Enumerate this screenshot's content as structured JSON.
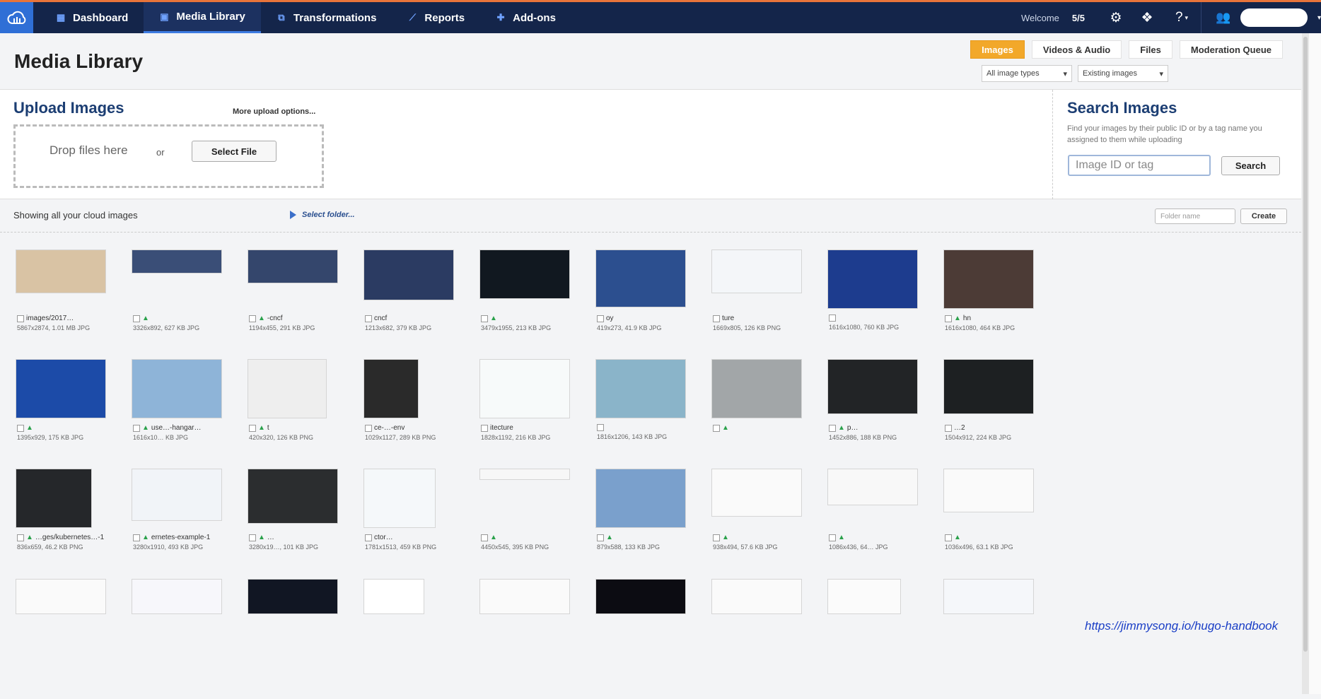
{
  "nav": {
    "items": [
      {
        "label": "Dashboard",
        "icon": "dashboard-icon",
        "glyph": "▦"
      },
      {
        "label": "Media Library",
        "icon": "media-library-icon",
        "glyph": "▣"
      },
      {
        "label": "Transformations",
        "icon": "transformations-icon",
        "glyph": "⧉"
      },
      {
        "label": "Reports",
        "icon": "reports-icon",
        "glyph": "⟋"
      },
      {
        "label": "Add-ons",
        "icon": "puzzle-icon",
        "glyph": "✚"
      }
    ],
    "welcome_label": "Welcome",
    "quota": "5/5"
  },
  "header": {
    "title": "Media Library",
    "tabs": [
      "Images",
      "Videos & Audio",
      "Files",
      "Moderation Queue"
    ],
    "active_tab": "Images",
    "filter_type": "All image types",
    "filter_state": "Existing images"
  },
  "upload": {
    "title": "Upload Images",
    "more_options": "More upload options...",
    "drop_text": "Drop files here",
    "or_text": "or",
    "select_file": "Select File"
  },
  "search": {
    "title": "Search Images",
    "description": "Find your images by their public ID or by a tag name you assigned to them while uploading",
    "placeholder": "Image ID or tag",
    "button": "Search"
  },
  "folders": {
    "showing": "Showing all your cloud images",
    "select_folder": "Select folder...",
    "folder_placeholder": "Folder name",
    "create": "Create"
  },
  "images": [
    {
      "name": "images/2017…",
      "meta": "5867x2874, 1.01 MB JPG",
      "tagged": false,
      "color": "#d9c3a4"
    },
    {
      "name": "",
      "meta": "3326x892, 627 KB JPG",
      "tagged": true,
      "color": "#3a4e77"
    },
    {
      "name": "-cncf",
      "meta": "1194x455, 291 KB JPG",
      "tagged": true,
      "color": "#34466c"
    },
    {
      "name": "cncf",
      "meta": "1213x682, 379 KB JPG",
      "tagged": false,
      "color": "#2b3b62"
    },
    {
      "name": "",
      "meta": "3479x1955, 213 KB JPG",
      "tagged": true,
      "color": "#111820"
    },
    {
      "name": "oy",
      "meta": "419x273, 41.9 KB JPG",
      "tagged": false,
      "color": "#2c4f8f"
    },
    {
      "name": "ture",
      "meta": "1669x805, 126 KB PNG",
      "tagged": false,
      "color": "#f4f6f9"
    },
    {
      "name": "",
      "meta": "1616x1080, 760 KB JPG",
      "tagged": false,
      "color": "#1d3c8e"
    },
    {
      "name": "hn",
      "meta": "1616x1080, 464 KB JPG",
      "tagged": true,
      "color": "#4c3b36"
    },
    {
      "name": "",
      "meta": "1395x929, 175 KB JPG",
      "tagged": true,
      "color": "#1c4ba8"
    },
    {
      "name": "use…-hangar…",
      "meta": "1616x10… KB JPG",
      "tagged": true,
      "color": "#8eb4d8"
    },
    {
      "name": "t",
      "meta": "420x320, 126 KB PNG",
      "tagged": true,
      "color": "#eeeeee"
    },
    {
      "name": "ce-…-env",
      "meta": "1029x1127, 289 KB PNG",
      "tagged": false,
      "color": "#2a2a2a"
    },
    {
      "name": "itecture",
      "meta": "1828x1192, 216 KB JPG",
      "tagged": false,
      "color": "#f7fafa"
    },
    {
      "name": "",
      "meta": "1816x1206, 143 KB JPG",
      "tagged": false,
      "color": "#8ab4c9"
    },
    {
      "name": "",
      "meta": "",
      "tagged": true,
      "color": "#a2a6a8"
    },
    {
      "name": "p…",
      "meta": "1452x886, 188 KB PNG",
      "tagged": true,
      "color": "#222426"
    },
    {
      "name": "…2",
      "meta": "1504x912, 224 KB JPG",
      "tagged": false,
      "color": "#1d2022"
    },
    {
      "name": "…ges/kubernetes…-1",
      "meta": "836x659, 46.2 KB PNG",
      "tagged": true,
      "color": "#25272a"
    },
    {
      "name": "ernetes-example-1",
      "meta": "3280x1910, 493 KB JPG",
      "tagged": true,
      "color": "#f1f4f8"
    },
    {
      "name": "…",
      "meta": "3280x19…, 101 KB JPG",
      "tagged": true,
      "color": "#2b2d2f"
    },
    {
      "name": "ctor…",
      "meta": "1781x1513, 459 KB PNG",
      "tagged": false,
      "color": "#f5f8fa"
    },
    {
      "name": "",
      "meta": "4450x545, 395 KB PNG",
      "tagged": true,
      "color": "#f7f7f7"
    },
    {
      "name": "",
      "meta": "879x588, 133 KB JPG",
      "tagged": true,
      "color": "#7aa0cc"
    },
    {
      "name": "",
      "meta": "938x494, 57.6 KB JPG",
      "tagged": true,
      "color": "#fafafa"
    },
    {
      "name": "",
      "meta": "1086x436, 64… JPG",
      "tagged": true,
      "color": "#f8f8f8"
    },
    {
      "name": "",
      "meta": "1036x496, 63.1 KB JPG",
      "tagged": true,
      "color": "#fafafa"
    },
    {
      "name": "",
      "meta": "",
      "tagged": false,
      "color": "#fafafa"
    },
    {
      "name": "",
      "meta": "",
      "tagged": false,
      "color": "#f7f7fb"
    },
    {
      "name": "",
      "meta": "",
      "tagged": false,
      "color": "#111623"
    },
    {
      "name": "",
      "meta": "",
      "tagged": false,
      "color": "#ffffff"
    },
    {
      "name": "",
      "meta": "",
      "tagged": false,
      "color": "#fafafa"
    },
    {
      "name": "",
      "meta": "",
      "tagged": false,
      "color": "#0c0c12"
    },
    {
      "name": "",
      "meta": "",
      "tagged": false,
      "color": "#fafafa"
    },
    {
      "name": "",
      "meta": "",
      "tagged": false,
      "color": "#fbfbfb"
    },
    {
      "name": "",
      "meta": "",
      "tagged": false,
      "color": "#f5f7fa"
    }
  ],
  "watermark": "https://jimmysong.io/hugo-handbook"
}
